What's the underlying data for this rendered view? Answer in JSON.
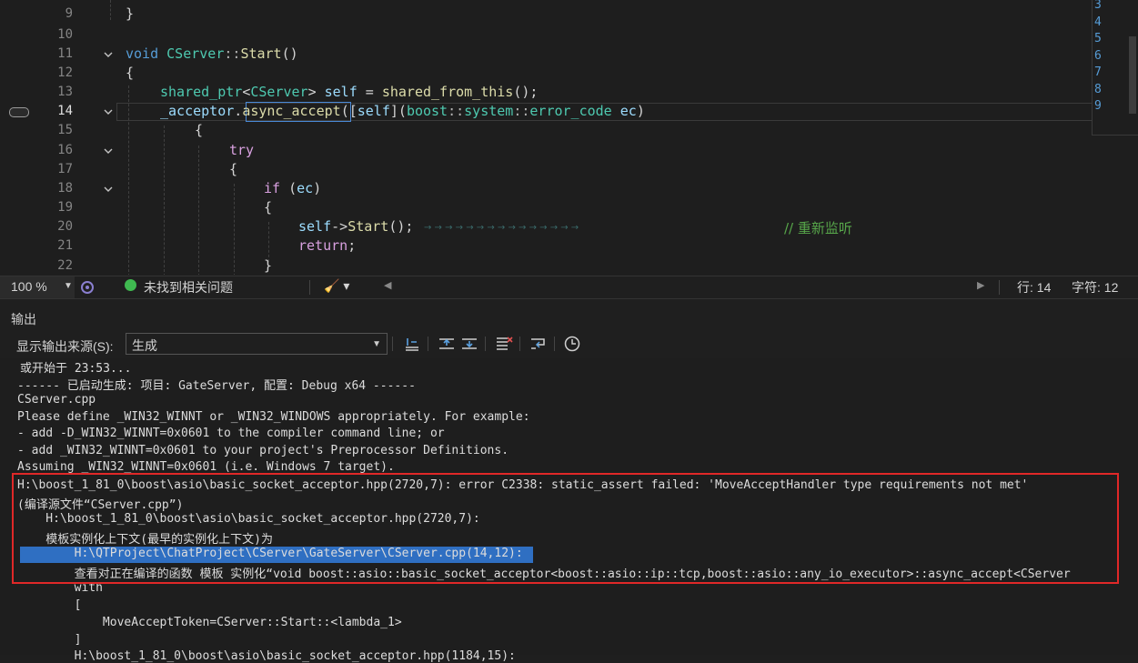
{
  "editor": {
    "lines": [
      {
        "num": "9"
      },
      {
        "num": "10"
      },
      {
        "num": "11"
      },
      {
        "num": "12"
      },
      {
        "num": "13"
      },
      {
        "num": "14"
      },
      {
        "num": "15"
      },
      {
        "num": "16"
      },
      {
        "num": "17"
      },
      {
        "num": "18"
      },
      {
        "num": "19"
      },
      {
        "num": "20"
      },
      {
        "num": "21"
      },
      {
        "num": "22"
      }
    ],
    "code": {
      "l9": "}",
      "l11_kw": "void",
      "l11_cls": "CServer",
      "l11_sep": "::",
      "l11_fn": "Start",
      "l11_rest": "()",
      "l12": "{",
      "l13_ty": "shared_ptr",
      "l13_lt": "<",
      "l13_cls": "CServer",
      "l13_gt": ">",
      "l13_var": "self",
      "l13_eq": "=",
      "l13_fn": "shared_from_this",
      "l13_end": "();",
      "l14_var": "_acceptor",
      "l14_dot": ".",
      "l14_fn": "async_accept",
      "l14_cap_open": "([",
      "l14_cap": "self",
      "l14_cap_close": "](",
      "l14_ns1": "boost",
      "l14_sep1": "::",
      "l14_ns2": "system",
      "l14_sep2": "::",
      "l14_ty": "error_code",
      "l14_param": "ec",
      "l14_end": ")",
      "l15": "{",
      "l16": "try",
      "l17": "{",
      "l18_kw": "if",
      "l18_open": " (",
      "l18_var": "ec",
      "l18_close": ")",
      "l19": "{",
      "l20_var": "self",
      "l20_arrow": "->",
      "l20_fn": "Start",
      "l20_end": "();",
      "l20_comment": "// 重新监听",
      "l21_kw": "return",
      "l21_end": ";",
      "l22": "}"
    },
    "peek_lines": [
      "3",
      "4",
      "5",
      "6",
      "7",
      "8",
      "9"
    ]
  },
  "statusbar": {
    "zoom": "100 %",
    "issues": "未找到相关问题",
    "row": "行: 14",
    "col": "字符: 12"
  },
  "output": {
    "title": "输出",
    "source_label": "显示输出来源(S):",
    "source_value": "生成",
    "lines": [
      "或开始于 23:53...",
      "------ 已启动生成: 项目: GateServer, 配置: Debug x64 ------",
      "CServer.cpp",
      "Please define _WIN32_WINNT or _WIN32_WINDOWS appropriately. For example:",
      "- add -D_WIN32_WINNT=0x0601 to the compiler command line; or",
      "- add _WIN32_WINNT=0x0601 to your project's Preprocessor Definitions.",
      "Assuming _WIN32_WINNT=0x0601 (i.e. Windows 7 target).",
      "H:\\boost_1_81_0\\boost\\asio\\basic_socket_acceptor.hpp(2720,7): error C2338: static_assert failed: 'MoveAcceptHandler type requirements not met'",
      "(编译源文件“CServer.cpp”)",
      "    H:\\boost_1_81_0\\boost\\asio\\basic_socket_acceptor.hpp(2720,7):",
      "    模板实例化上下文(最早的实例化上下文)为",
      "        H:\\QTProject\\ChatProject\\CServer\\GateServer\\CServer.cpp(14,12):",
      "        查看对正在编译的函数 模板 实例化“void boost::asio::basic_socket_acceptor<boost::asio::ip::tcp,boost::asio::any_io_executor>::async_accept<CServer",
      "        with",
      "        [",
      "            MoveAcceptToken=CServer::Start::<lambda_1>",
      "        ]",
      "        H:\\boost_1_81_0\\boost\\asio\\basic_socket_acceptor.hpp(1184,15):"
    ]
  },
  "colors": {
    "highlight_box": "#e02828",
    "selection": "#2f6fc2",
    "ok_status": "#3fb950"
  }
}
